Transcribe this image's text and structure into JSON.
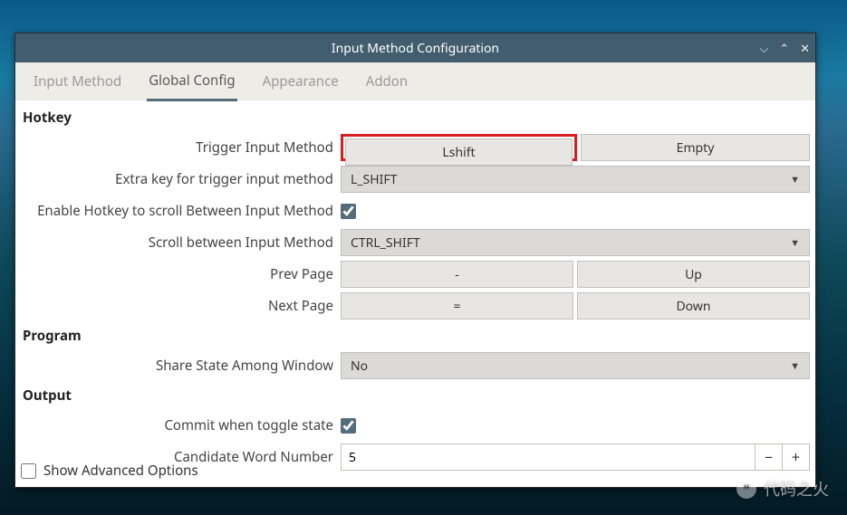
{
  "window": {
    "title": "Input Method Configuration"
  },
  "tabs": [
    "Input Method",
    "Global Config",
    "Appearance",
    "Addon"
  ],
  "active_tab_index": 1,
  "sections": {
    "hotkey": {
      "title": "Hotkey",
      "trigger_label": "Trigger Input Method",
      "trigger_btn1": "Lshift",
      "trigger_btn2": "Empty",
      "extra_key_label": "Extra key for trigger input method",
      "extra_key_value": "L_SHIFT",
      "enable_scroll_label": "Enable Hotkey to scroll Between Input Method",
      "enable_scroll_checked": true,
      "scroll_label": "Scroll between Input Method",
      "scroll_value": "CTRL_SHIFT",
      "prev_page_label": "Prev Page",
      "prev_page_btn1": "-",
      "prev_page_btn2": "Up",
      "next_page_label": "Next Page",
      "next_page_btn1": "=",
      "next_page_btn2": "Down"
    },
    "program": {
      "title": "Program",
      "share_state_label": "Share State Among Window",
      "share_state_value": "No"
    },
    "output": {
      "title": "Output",
      "commit_toggle_label": "Commit when toggle state",
      "commit_toggle_checked": true,
      "candidate_label": "Candidate Word Number",
      "candidate_value": "5"
    }
  },
  "footer": {
    "show_advanced_label": "Show Advanced Options",
    "show_advanced_checked": false
  },
  "watermark": "代码之火"
}
